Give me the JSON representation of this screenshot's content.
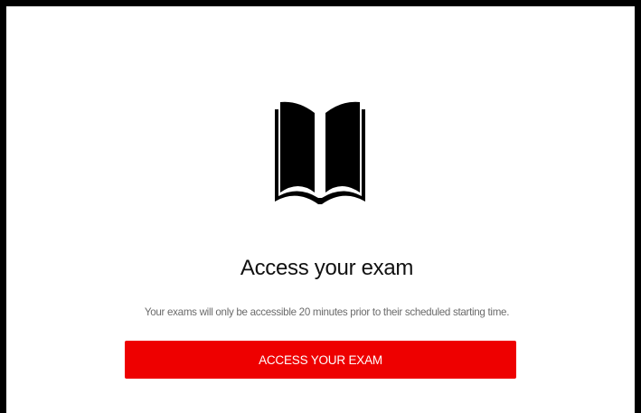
{
  "exam_access": {
    "icon": "open-book-icon",
    "title": "Access your exam",
    "subtitle": "Your exams will only be accessible 20 minutes prior to their scheduled starting time.",
    "button_label": "ACCESS YOUR EXAM"
  },
  "colors": {
    "accent": "#EE0000",
    "frame": "#000000",
    "text_primary": "#111111",
    "text_secondary": "#6B6B6B"
  }
}
